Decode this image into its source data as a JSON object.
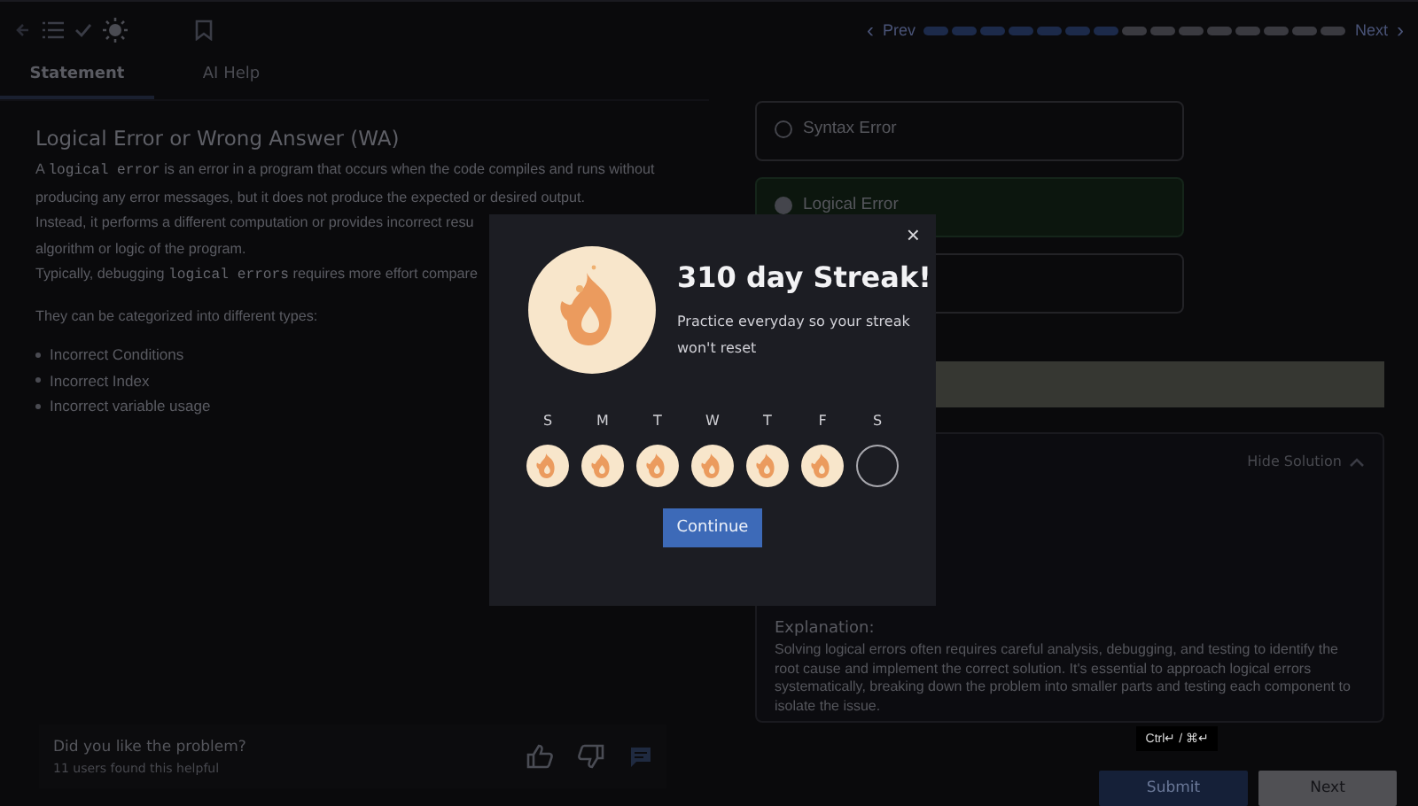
{
  "top_bar": {
    "prev_arrow": "‹",
    "prev": "Prev",
    "next": "Next",
    "next_arrow": "›",
    "progress": [
      {
        "done": true
      },
      {
        "done": true
      },
      {
        "done": true
      },
      {
        "done": true
      },
      {
        "done": true
      },
      {
        "done": true
      },
      {
        "done": true
      },
      {
        "done": false
      },
      {
        "done": false
      },
      {
        "done": false
      },
      {
        "done": false
      },
      {
        "done": false
      },
      {
        "done": false
      },
      {
        "done": false
      },
      {
        "done": false
      }
    ]
  },
  "tabs": [
    {
      "label": "Statement",
      "selected": true
    },
    {
      "label": "AI Help",
      "selected": false
    }
  ],
  "statement": {
    "title": "Logical Error or Wrong Answer (WA)",
    "lines": [
      [
        {
          "text": "A "
        },
        {
          "code": "logical error"
        },
        {
          "text": " is an error in a program that occurs when the code compiles and runs without"
        }
      ],
      [
        {
          "text": "producing any error messages, but it does not produce the expected or desired output."
        }
      ],
      [
        {
          "text": "Instead, it performs a different computation or provides incorrect resu"
        }
      ],
      [
        {
          "text": "algorithm or logic of the program."
        }
      ],
      [
        {
          "text": "Typically, debugging "
        },
        {
          "code": "logical errors"
        },
        {
          "text": " requires more effort compare"
        }
      ]
    ],
    "intro": "They can be categorized into different types:",
    "bullets": [
      "Incorrect Conditions",
      "Incorrect Index",
      "Incorrect variable usage"
    ]
  },
  "feedback": {
    "question": "Did you like the problem?",
    "count": "11 users found this helpful"
  },
  "options": [
    {
      "label": "Syntax Error",
      "selected": false
    },
    {
      "label": "Logical Error",
      "selected": true
    },
    {
      "selected": false
    }
  ],
  "solution": {
    "toggle": "Hide Solution",
    "heading": "Explanation:",
    "text": " Solving logical errors often requires careful analysis, debugging, and testing to identify the root cause and implement the correct solution. It's essential to approach logical errors systematically, breaking down the problem into smaller parts and testing each component to isolate the issue."
  },
  "shortcut": "Ctrl↵ / ⌘↵",
  "buttons": {
    "submit": "Submit",
    "next": "Next"
  },
  "modal": {
    "title": "310 day Streak!",
    "message": "Practice everyday so your streak won't reset",
    "close": "×",
    "button": "Continue",
    "days": [
      {
        "letter": "S",
        "done": true
      },
      {
        "letter": "M",
        "done": true
      },
      {
        "letter": "T",
        "done": true
      },
      {
        "letter": "W",
        "done": true
      },
      {
        "letter": "T",
        "done": true
      },
      {
        "letter": "F",
        "done": true
      },
      {
        "letter": "S",
        "done": false
      }
    ]
  }
}
